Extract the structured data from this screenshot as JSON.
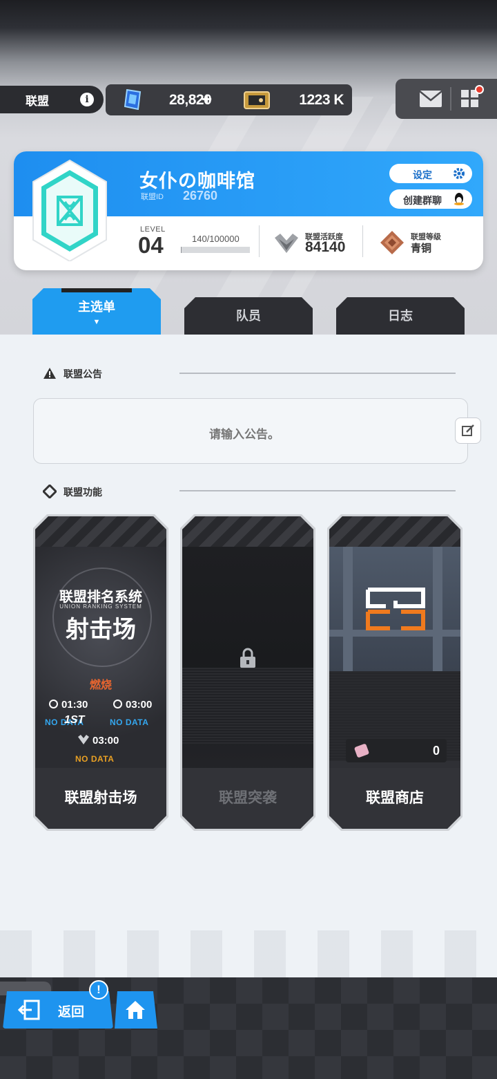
{
  "topbar": {
    "union_label": "联盟",
    "info_icon": "info-icon",
    "gem_value": "28,820",
    "plus_label": "+",
    "ticket_value": "1223 K",
    "mail_icon": "mail-icon",
    "menu_icon": "grid-menu-icon"
  },
  "union": {
    "name": "女仆の咖啡馆",
    "id_label": "联盟ID",
    "id_value": "26760",
    "settings_label": "设定",
    "chat_label": "创建群聊",
    "level_label": "LEVEL",
    "level_value": "04",
    "exp_text": "140/100000",
    "exp_progress": 0.0014,
    "activity_label": "联盟活跃度",
    "activity_value": "84140",
    "rank_label": "联盟等级",
    "rank_value": "青铜"
  },
  "tabs": {
    "main": "主选单",
    "members": "队员",
    "log": "日志",
    "main_caret": "▼"
  },
  "notice": {
    "section_title": "联盟公告",
    "placeholder": "请输入公告。"
  },
  "features": {
    "section_title": "联盟功能",
    "shooting": {
      "art_title": "联盟排名系统",
      "art_subtitle": "UNION RANKING SYSTEM",
      "art_main": "射击场",
      "status": "燃烧",
      "time1": "01:30",
      "time2": "03:00",
      "time3": "03:00",
      "first_mark": "1ST",
      "nd1": "NO DATA",
      "nd2": "NO DATA",
      "nd3": "NO DATA",
      "label": "联盟射击场"
    },
    "raid": {
      "label": "联盟突袭"
    },
    "shop": {
      "count": "0",
      "label": "联盟商店"
    }
  },
  "bottom": {
    "back_label": "返回",
    "alert_badge": "!"
  },
  "colors": {
    "accent_blue": "#1e94ef",
    "burn_orange": "#e8652f",
    "nodata_blue": "#34a7ef",
    "nodata_orange": "#e8a024"
  }
}
